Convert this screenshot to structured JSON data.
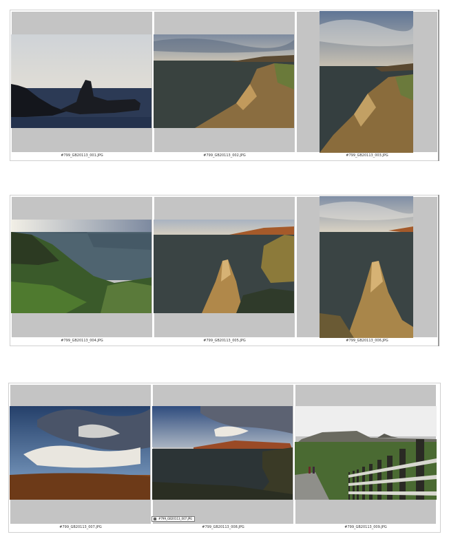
{
  "sheets": [
    {
      "files": [
        "#799_GB20113_001.JPG",
        "#799_GB20113_002.JPG",
        "#799_GB20113_003.JPG"
      ]
    },
    {
      "files": [
        "#799_GB20113_004.JPG",
        "#799_GB20113_005.JPG",
        "#799_GB20113_006.JPG"
      ]
    },
    {
      "files": [
        "#799_GB20113_007.JPG",
        "#799_GB20113_008.JPG",
        "#799_GB20113_009.JPG"
      ]
    }
  ],
  "tooltip": {
    "label": "#799_GB20113_007.JPG"
  },
  "colors": {
    "cell_bg": "#c4c4c4",
    "frame": "#d7d7d7",
    "page_bg": "#ffffff"
  }
}
